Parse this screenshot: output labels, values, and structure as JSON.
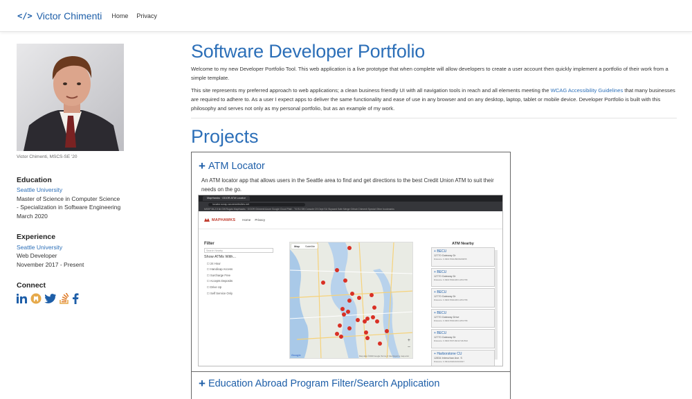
{
  "nav": {
    "brand_icon": "</>",
    "brand": "Victor Chimenti",
    "links": [
      "Home",
      "Privacy"
    ]
  },
  "sidebar": {
    "photo_caption": "Victor Chimenti, MSCS-SE '20",
    "education": {
      "heading": "Education",
      "school": "Seattle University",
      "degree": "Master of Science in Computer Science",
      "specialization": "- Specialization in Software Engineering",
      "date": "March 2020"
    },
    "experience": {
      "heading": "Experience",
      "employer": "Seattle University",
      "role": "Web Developer",
      "dates": "November 2017 - Present"
    },
    "connect": {
      "heading": "Connect",
      "icons": [
        "linkedin-icon",
        "github-icon",
        "twitter-icon",
        "stackoverflow-icon",
        "facebook-icon"
      ]
    }
  },
  "main": {
    "title": "Software Developer Portfolio",
    "intro": "Welcome to my new Developer Portfolio Tool. This web application is a live prototype that when complete will allow developers to create a user account then quickly implement a portfolio of their work from a simple template.",
    "approach_before": "This site represents my preferred approach to web applications; a clean business friendly UI with all navigation tools in reach and all elements meeting the ",
    "approach_link": "WCAG Accessibility Guidelines",
    "approach_after": " that many businesses are required to adhere to. As a user I expect apps to deliver the same functionality and ease of use in any browser and on any desktop, laptop, tablet or mobile device. Developer Portfolio is built with this philosophy and serves not only as my personal portfolio, but as an example of my work.",
    "projects_heading": "Projects",
    "projects": [
      {
        "title": "ATM Locator",
        "description": "An ATM locator app that allows users in the Seattle area to find and get directions to the best Credit Union ATM to suit their needs on the go."
      },
      {
        "title": "Education Abroad Program Filter/Search Application"
      }
    ]
  },
  "screenshot": {
    "tab": "MapHawks · ODOR ATM Locator",
    "url": "locator.scrap.azurewebsites.net",
    "bookmarks": "MSSP ML2.5 kb   Gift Rugzis   MapHawks · OOOR   Chimenti   Azure   Google Cloud Platf...   T4 EU   DB Console   CS Dept SU   Skyward   Safe Merge Github   Chimenti Special   Other bookmarks",
    "logo": "MAPHAWKS",
    "app_nav": [
      "Home",
      "Privacy"
    ],
    "filter": {
      "heading": "Filter",
      "search_placeholder": "Search Nearby",
      "subheading": "Show ATMs With...",
      "options": [
        "24 Hour",
        "Handicap Access",
        "Surcharge Free",
        "Accepts Deposits",
        "Drive Up",
        "Self Service Only"
      ]
    },
    "map": {
      "tabs": [
        "Map",
        "Satellite"
      ],
      "google": "Google",
      "footer": "Map data ©2020 Google   Terms of Use   Report a map error"
    },
    "nearby": {
      "heading": "ATM Nearby",
      "items": [
        {
          "name": "BECU",
          "addr": "12770 Gateway Dr",
          "dist": "Distance: 0.0901780245828180655"
        },
        {
          "name": "BECU",
          "addr": "12770 Gateway Dr",
          "dist": "Distance: 0.090178024453 2251758"
        },
        {
          "name": "BECU",
          "addr": "12770 Gateway Dr",
          "dist": "Distance: 0.090178024453 2251758"
        },
        {
          "name": "BECU",
          "addr": "12770 Gateway Drive",
          "dist": "Distance: 0.090178024453 2251758"
        },
        {
          "name": "BECU",
          "addr": "12770 Gateway Dr",
          "dist": "Distance: 0.09017807160117461532"
        },
        {
          "name": "Harborstone CU",
          "addr": "12834 Interurban Ave. S",
          "dist": "Distance: 0.09112918210013647"
        }
      ]
    }
  }
}
